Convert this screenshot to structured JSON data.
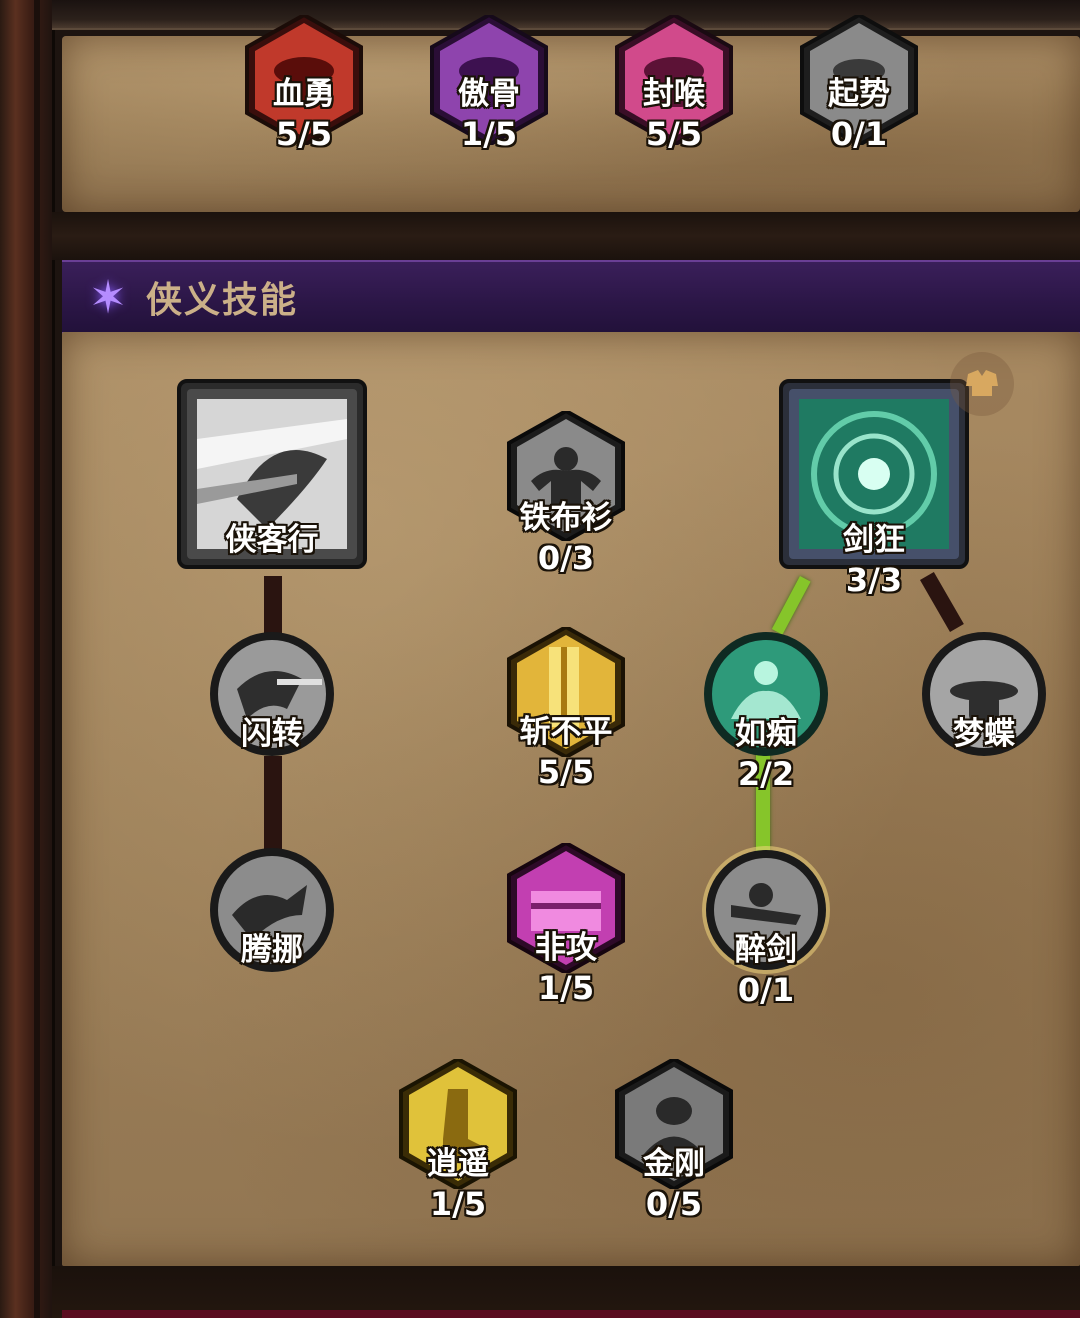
{
  "top_skills": [
    {
      "name": "血勇",
      "level": "5/5",
      "color": "#c0392b",
      "icon": "red-hooded-figure-icon"
    },
    {
      "name": "傲骨",
      "level": "1/5",
      "color": "#8e44ad",
      "icon": "purple-hooded-figure-icon"
    },
    {
      "name": "封喉",
      "level": "5/5",
      "color": "#d14a8b",
      "icon": "pink-hooded-figure-icon"
    },
    {
      "name": "起势",
      "level": "0/1",
      "color": "#7f7f7f",
      "icon": "grey-warrior-icon"
    }
  ],
  "section": {
    "title": "侠义技能",
    "icon": "purple-star-icon"
  },
  "tree": {
    "xiakexing": {
      "name": "侠客行",
      "color": "#d0d0d0",
      "icon": "ninja-dash-icon"
    },
    "tiebushan": {
      "name": "铁布衫",
      "level": "0/3",
      "color": "#8a8a8a",
      "icon": "muscle-man-icon"
    },
    "jiankuang": {
      "name": "剑狂",
      "level": "3/3",
      "color": "#3fb38f",
      "icon": "sword-vortex-icon"
    },
    "shanzhuan": {
      "name": "闪转",
      "color": "#9a9a9a",
      "icon": "dodge-figure-icon"
    },
    "zhanbuping": {
      "name": "斩不平",
      "level": "5/5",
      "color": "#e2b53a",
      "icon": "golden-blade-icon"
    },
    "ruchi": {
      "name": "如痴",
      "level": "2/2",
      "color": "#2e9a7a",
      "icon": "meditating-figure-icon"
    },
    "mengdie": {
      "name": "梦蝶",
      "color": "#9a9a9a",
      "icon": "hat-figure-icon"
    },
    "tengnuo": {
      "name": "腾挪",
      "color": "#8c8c8c",
      "icon": "leaping-figure-icon"
    },
    "feigong": {
      "name": "非攻",
      "level": "1/5",
      "color": "#c23fb1",
      "icon": "magenta-scroll-icon"
    },
    "zuijian": {
      "name": "醉剑",
      "level": "0/1",
      "color": "#8c8c8c",
      "icon": "drunken-sword-icon"
    },
    "xiaoyao": {
      "name": "逍遥",
      "level": "1/5",
      "color": "#e0c23a",
      "icon": "golden-boot-icon"
    },
    "jingang": {
      "name": "金刚",
      "level": "0/5",
      "color": "#7a7a7a",
      "icon": "vajra-body-icon"
    }
  },
  "gear_badge_icon": "armor-badge-icon"
}
